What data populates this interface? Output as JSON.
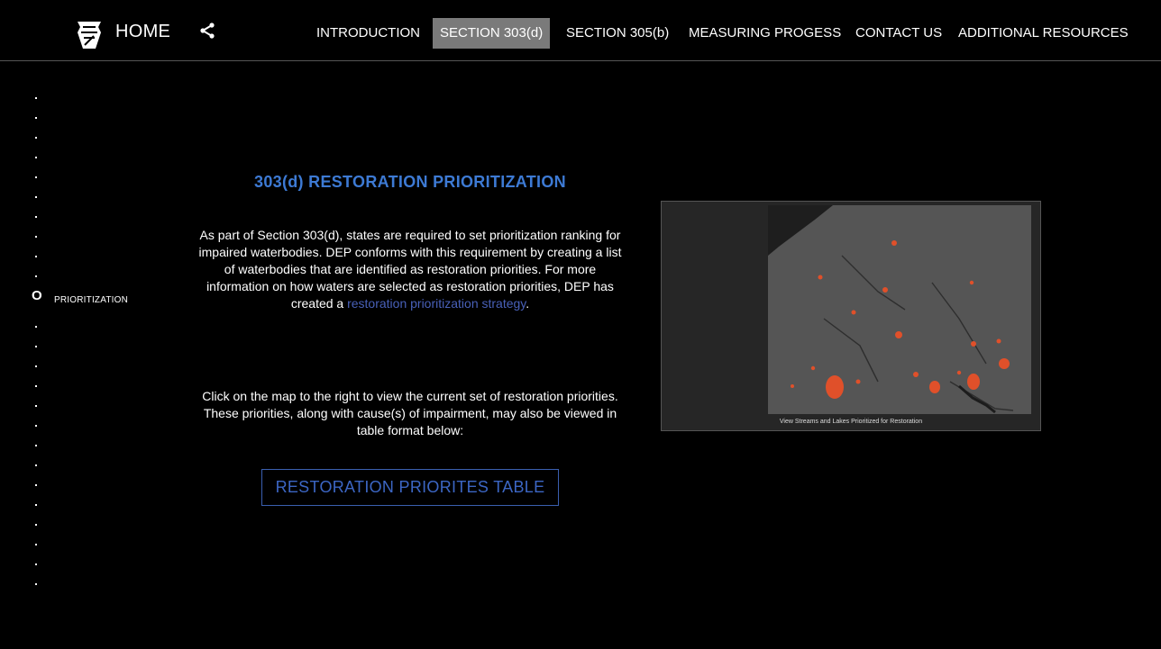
{
  "header": {
    "home_label": "HOME",
    "nav": [
      {
        "label": "INTRODUCTION",
        "active": false
      },
      {
        "label": "SECTION 303(d)",
        "active": true
      },
      {
        "label": "SECTION 305(b)",
        "active": false
      },
      {
        "label": "MEASURING PROGESS",
        "active": false
      },
      {
        "label": "CONTACT US",
        "active": false
      },
      {
        "label": "ADDITIONAL RESOURCES",
        "active": false
      }
    ],
    "icons": {
      "logo": "keystone-logo-icon",
      "share": "share-icon"
    }
  },
  "sidebar": {
    "current_marker": "O",
    "current_label": "PRIORITIZATION"
  },
  "main": {
    "title": "303(d) RESTORATION PRIORITIZATION",
    "paragraph1_prefix": "As part of Section 303(d), states are required to set prioritization ranking for impaired waterbodies. DEP conforms with this requirement by creating a list of waterbodies that are identified as restoration priorities. For more information on how waters are selected as restoration priorities, DEP has created a ",
    "paragraph1_link": "restoration prioritization strategy",
    "paragraph1_suffix": ".",
    "paragraph2": "Click on the map to the right to view the current set of restoration priorities. These priorities, along with cause(s) of impairment, may also be viewed in table format below:",
    "button_label": "RESTORATION PRIORITES TABLE",
    "map_caption": "View Streams and Lakes Prioritized for Restoration"
  },
  "colors": {
    "accent_title": "#3d7ad4",
    "link": "#4860b8",
    "active_tab_bg": "#7a7a7a",
    "map_highlight": "#e0502a"
  }
}
